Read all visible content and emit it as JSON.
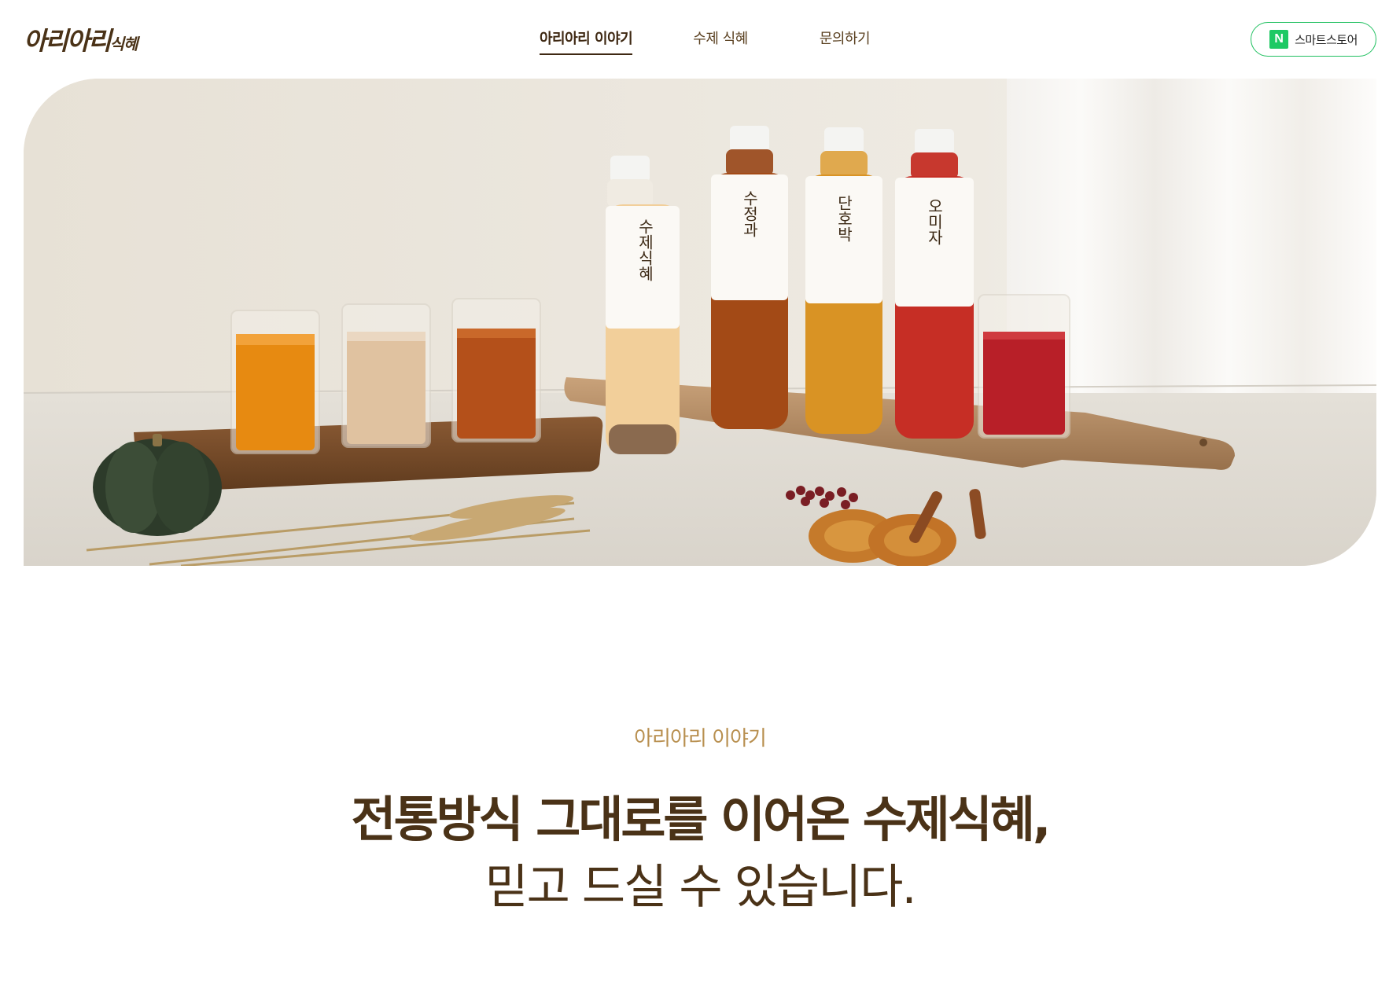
{
  "header": {
    "logo_main": "아리아리",
    "logo_small": "식혜",
    "nav": [
      {
        "label": "아리아리 이야기",
        "active": true
      },
      {
        "label": "수제 식혜",
        "active": false
      },
      {
        "label": "문의하기",
        "active": false
      }
    ],
    "store_button": {
      "icon": "naver-n-icon",
      "label": "스마트스토어"
    }
  },
  "hero": {
    "bottle_labels": [
      "수제식혜",
      "수정과",
      "단호박",
      "오미자"
    ]
  },
  "intro": {
    "eyebrow": "아리아리 이야기",
    "headline": "전통방식 그대로를 이어온 수제식혜,",
    "subline": "믿고 드실 수 있습니다."
  },
  "colors": {
    "brand_brown": "#4a3217",
    "eyebrow_gold": "#b88f4f",
    "naver_green": "#1ec964"
  }
}
